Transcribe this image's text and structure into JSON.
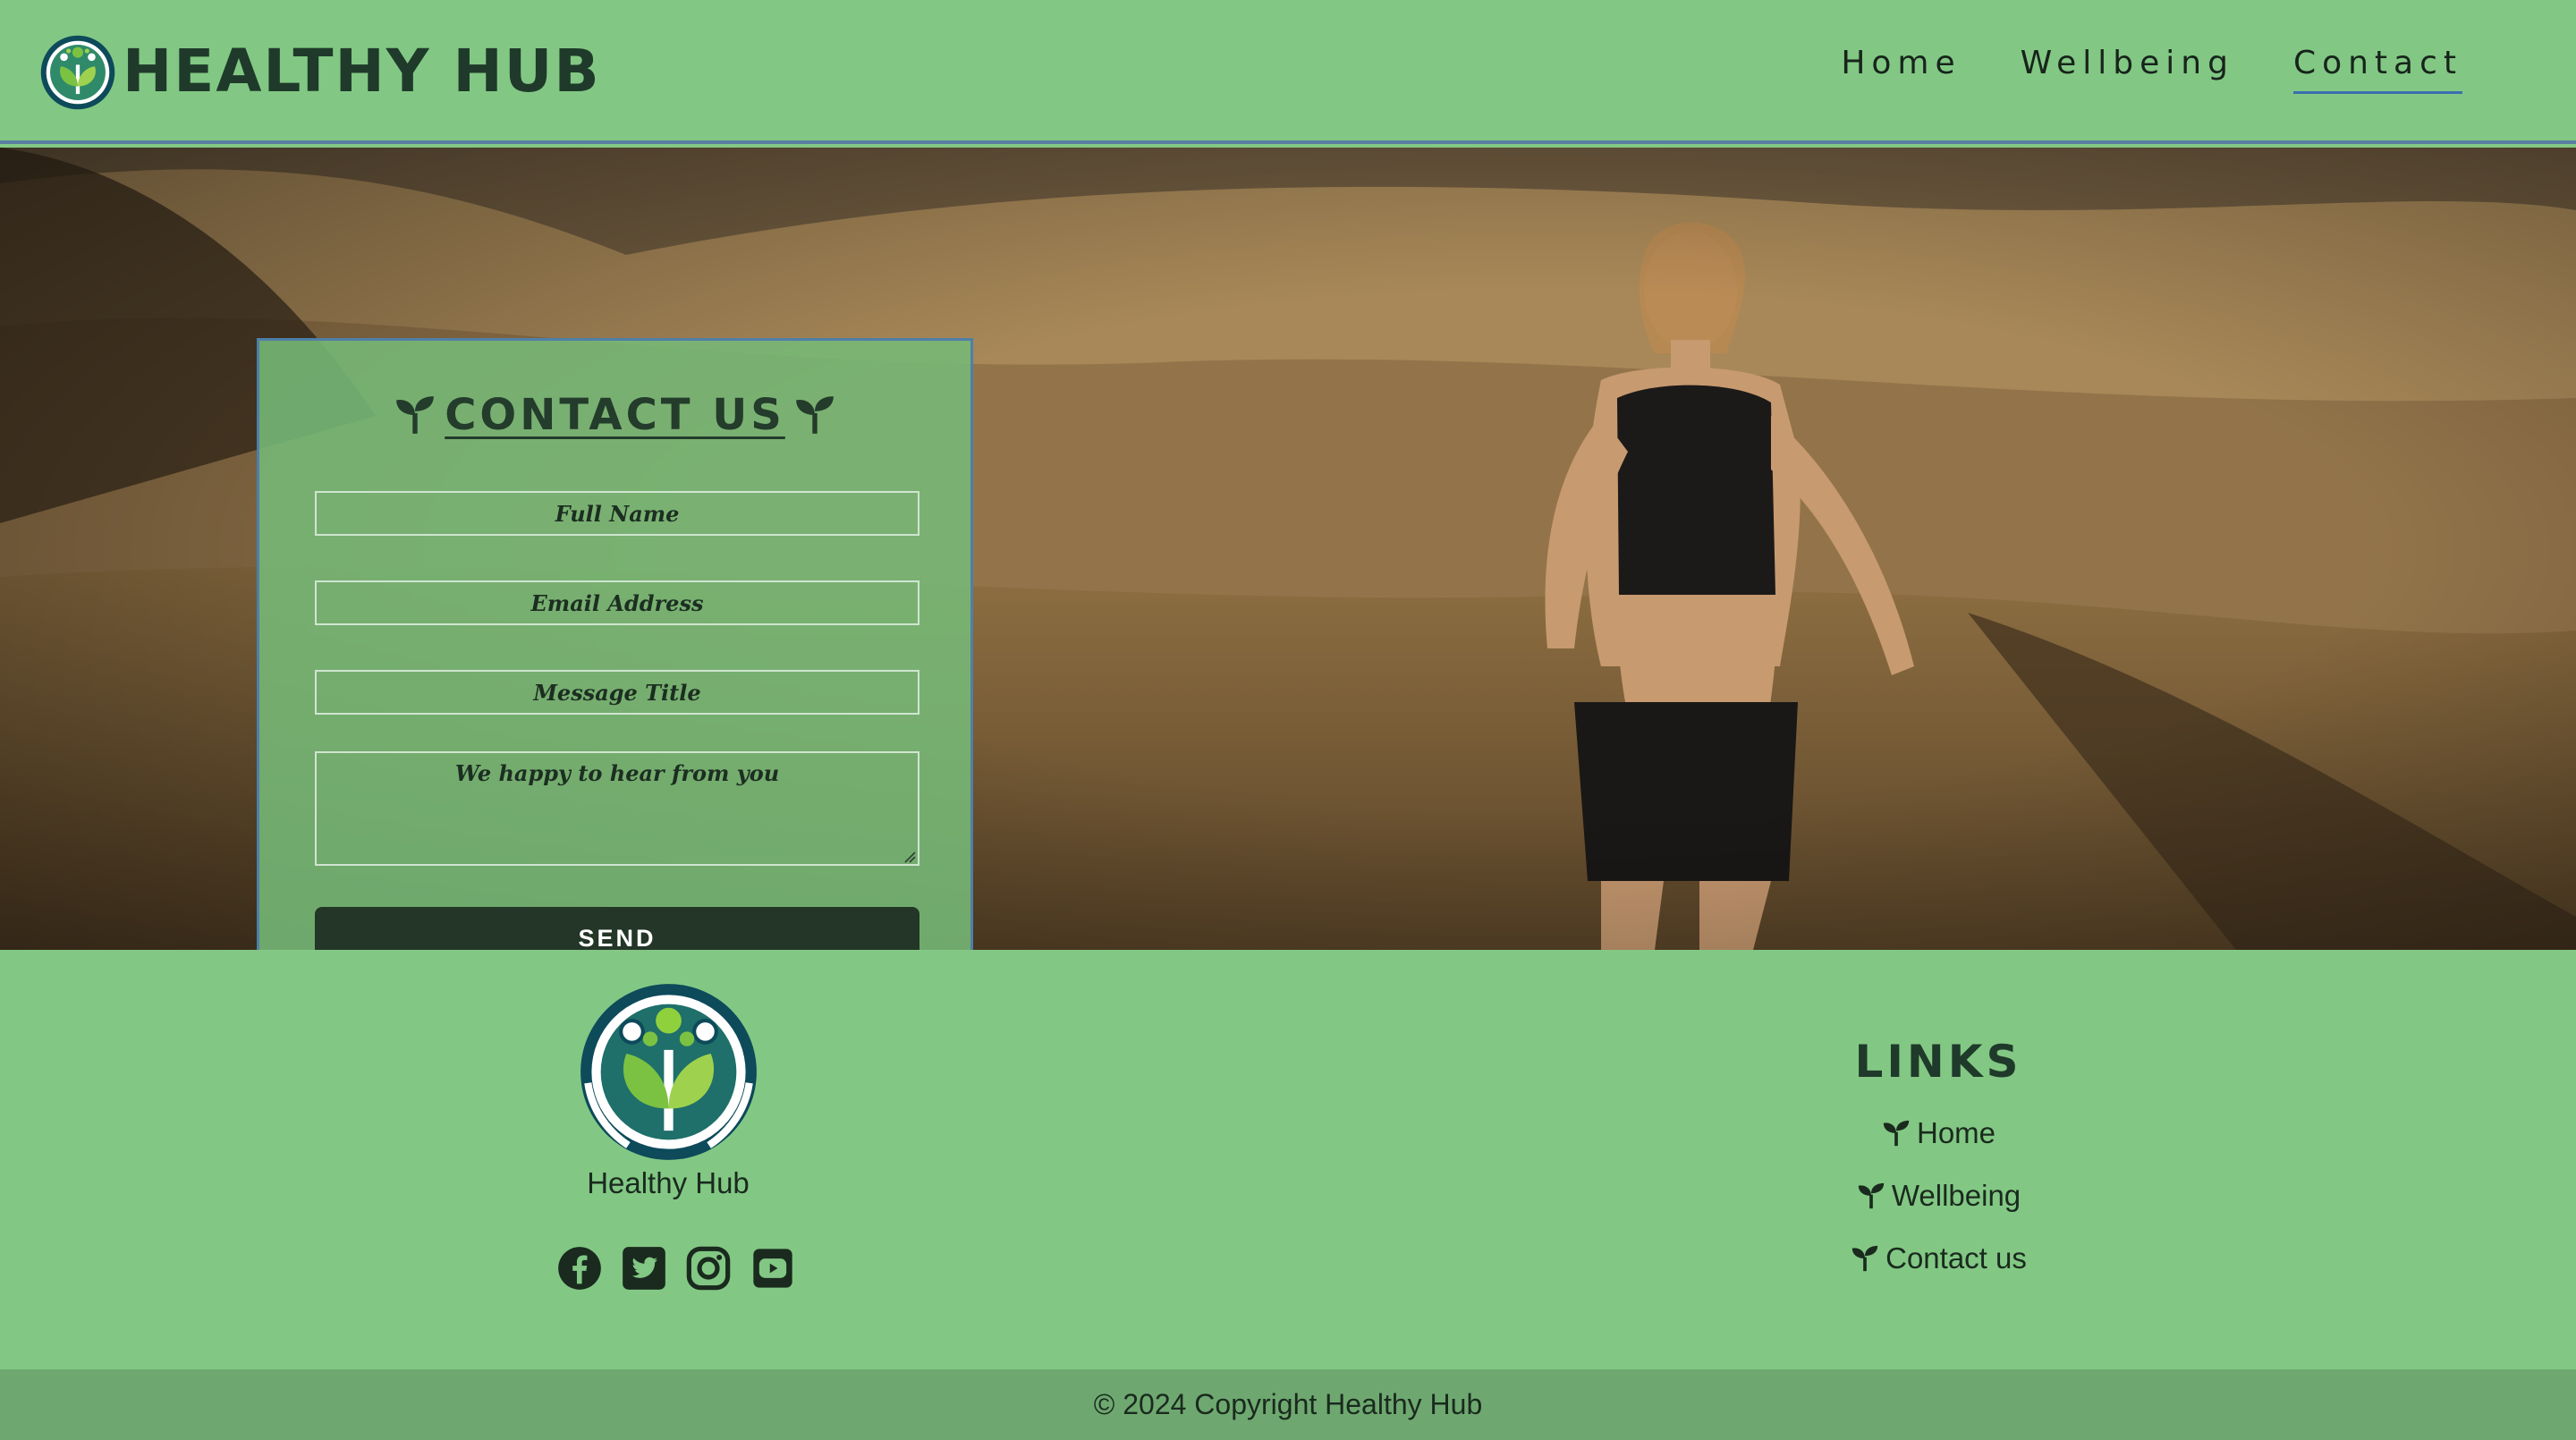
{
  "header": {
    "brand": "HEALTHY HUB",
    "nav": [
      {
        "label": "Home"
      },
      {
        "label": "Wellbeing"
      },
      {
        "label": "Contact"
      }
    ]
  },
  "contact_form": {
    "title": "CONTACT US",
    "full_name_placeholder": "Full Name",
    "email_placeholder": "Email Address",
    "message_title_placeholder": "Message Title",
    "message_placeholder": "We happy to hear from you",
    "send_label": "SEND"
  },
  "footer": {
    "brand": "Healthy Hub",
    "socials": [
      "facebook-icon",
      "twitter-icon",
      "instagram-icon",
      "youtube-icon"
    ],
    "links_heading": "LINKS",
    "links": [
      {
        "label": "Home"
      },
      {
        "label": "Wellbeing"
      },
      {
        "label": "Contact us"
      }
    ],
    "copyright": "© 2024 Copyright Healthy Hub"
  },
  "colors": {
    "header_bg": "#82c884",
    "dark_green": "#233628",
    "accent_blue": "#3a6fb0",
    "copyright_bg": "#6ea870"
  }
}
